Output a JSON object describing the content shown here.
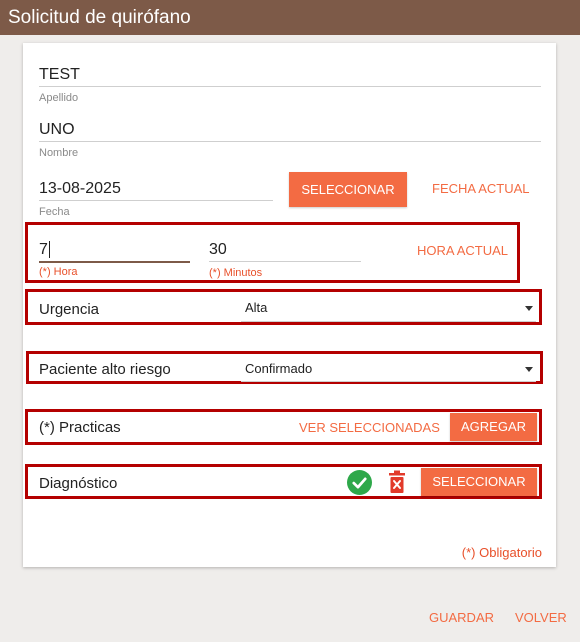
{
  "window": {
    "title": "Solicitud de quirófano"
  },
  "form": {
    "apellido": {
      "value": "TEST",
      "label": "Apellido"
    },
    "nombre": {
      "value": "UNO",
      "label": "Nombre"
    },
    "fecha": {
      "value": "13-08-2025",
      "label": "Fecha",
      "select_label": "SELECCIONAR",
      "today_label": "FECHA ACTUAL"
    },
    "hora": {
      "value": "7",
      "label": "(*) Hora"
    },
    "minutos": {
      "value": "30",
      "label": "(*) Minutos"
    },
    "hora_actual_label": "HORA ACTUAL",
    "urgencia": {
      "label": "Urgencia",
      "selected": "Alta"
    },
    "paciente_alto_riesgo": {
      "label": "Paciente alto riesgo",
      "selected": "Confirmado"
    },
    "practicas": {
      "label": "(*) Practicas",
      "ver_label": "VER SELECCIONADAS",
      "agregar_label": "AGREGAR"
    },
    "diagnostico": {
      "label": "Diagnóstico",
      "select_label": "SELECCIONAR",
      "confirm_icon": "check-circle-icon",
      "delete_icon": "trash-icon"
    },
    "obligatorio_note": "(*) Obligatorio"
  },
  "footer": {
    "guardar_label": "GUARDAR",
    "volver_label": "VOLVER"
  },
  "colors": {
    "header": "#7d5a48",
    "accent": "#f36b43",
    "highlight_border": "#b40000",
    "success": "#2ea84a",
    "danger": "#e23a2a"
  }
}
